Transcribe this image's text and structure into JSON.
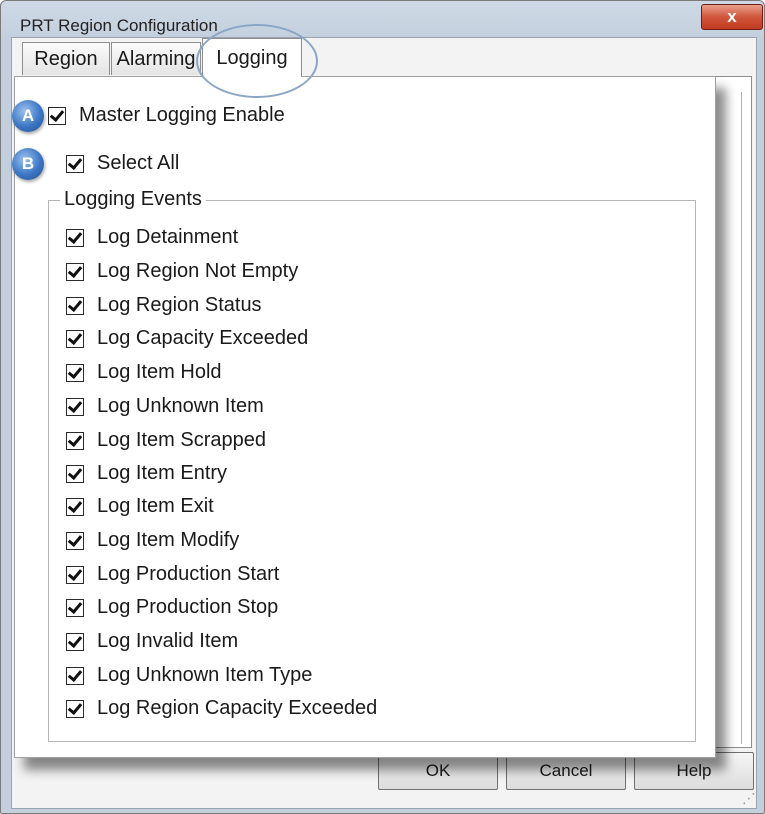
{
  "window": {
    "title": "PRT Region Configuration",
    "close_glyph": "x"
  },
  "tabs": [
    {
      "label": "Region"
    },
    {
      "label": "Alarming"
    },
    {
      "label": "Logging"
    }
  ],
  "markers": {
    "a": "A",
    "b": "B"
  },
  "master_logging": {
    "label": "Master Logging Enable",
    "checked": true
  },
  "select_all": {
    "label": "Select All",
    "checked": true
  },
  "logging_events": {
    "title": "Logging Events",
    "items": [
      {
        "label": "Log Detainment",
        "checked": true
      },
      {
        "label": "Log Region Not Empty",
        "checked": true
      },
      {
        "label": "Log Region Status",
        "checked": true
      },
      {
        "label": "Log Capacity Exceeded",
        "checked": true
      },
      {
        "label": "Log Item Hold",
        "checked": true
      },
      {
        "label": "Log Unknown Item",
        "checked": true
      },
      {
        "label": "Log Item Scrapped",
        "checked": true
      },
      {
        "label": "Log Item Entry",
        "checked": true
      },
      {
        "label": "Log Item Exit",
        "checked": true
      },
      {
        "label": "Log Item Modify",
        "checked": true
      },
      {
        "label": "Log Production Start",
        "checked": true
      },
      {
        "label": "Log Production Stop",
        "checked": true
      },
      {
        "label": "Log Invalid Item",
        "checked": true
      },
      {
        "label": "Log Unknown Item Type",
        "checked": true
      },
      {
        "label": "Log Region Capacity Exceeded",
        "checked": true
      }
    ]
  },
  "buttons": {
    "ok": "OK",
    "cancel": "Cancel",
    "help": "Help"
  },
  "colors": {
    "marker": "#3b76c4",
    "tab_highlight": "#8aa6c6",
    "close_button": "#c23a20"
  }
}
